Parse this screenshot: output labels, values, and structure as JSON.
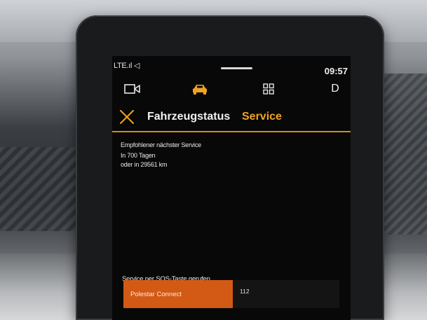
{
  "status_bar": {
    "network": "LTE.ıl ◁",
    "time": "09:57"
  },
  "nav": {
    "icons": [
      "camera-icon",
      "car-icon",
      "apps-grid-icon"
    ],
    "profile_letter": "D"
  },
  "header": {
    "title": "Fahrzeugstatus",
    "active_tab": "Service"
  },
  "service": {
    "recommended_label": "Empfohlener nächster Service",
    "days": "In 700 Tagen",
    "distance": "oder in 29561 km"
  },
  "sos": {
    "label": "Service per SOS-Taste gerufen",
    "button_label": "Polestar Connect",
    "number": "112"
  },
  "colors": {
    "accent": "#f0a322",
    "button": "#d35a14",
    "background": "#080808"
  }
}
